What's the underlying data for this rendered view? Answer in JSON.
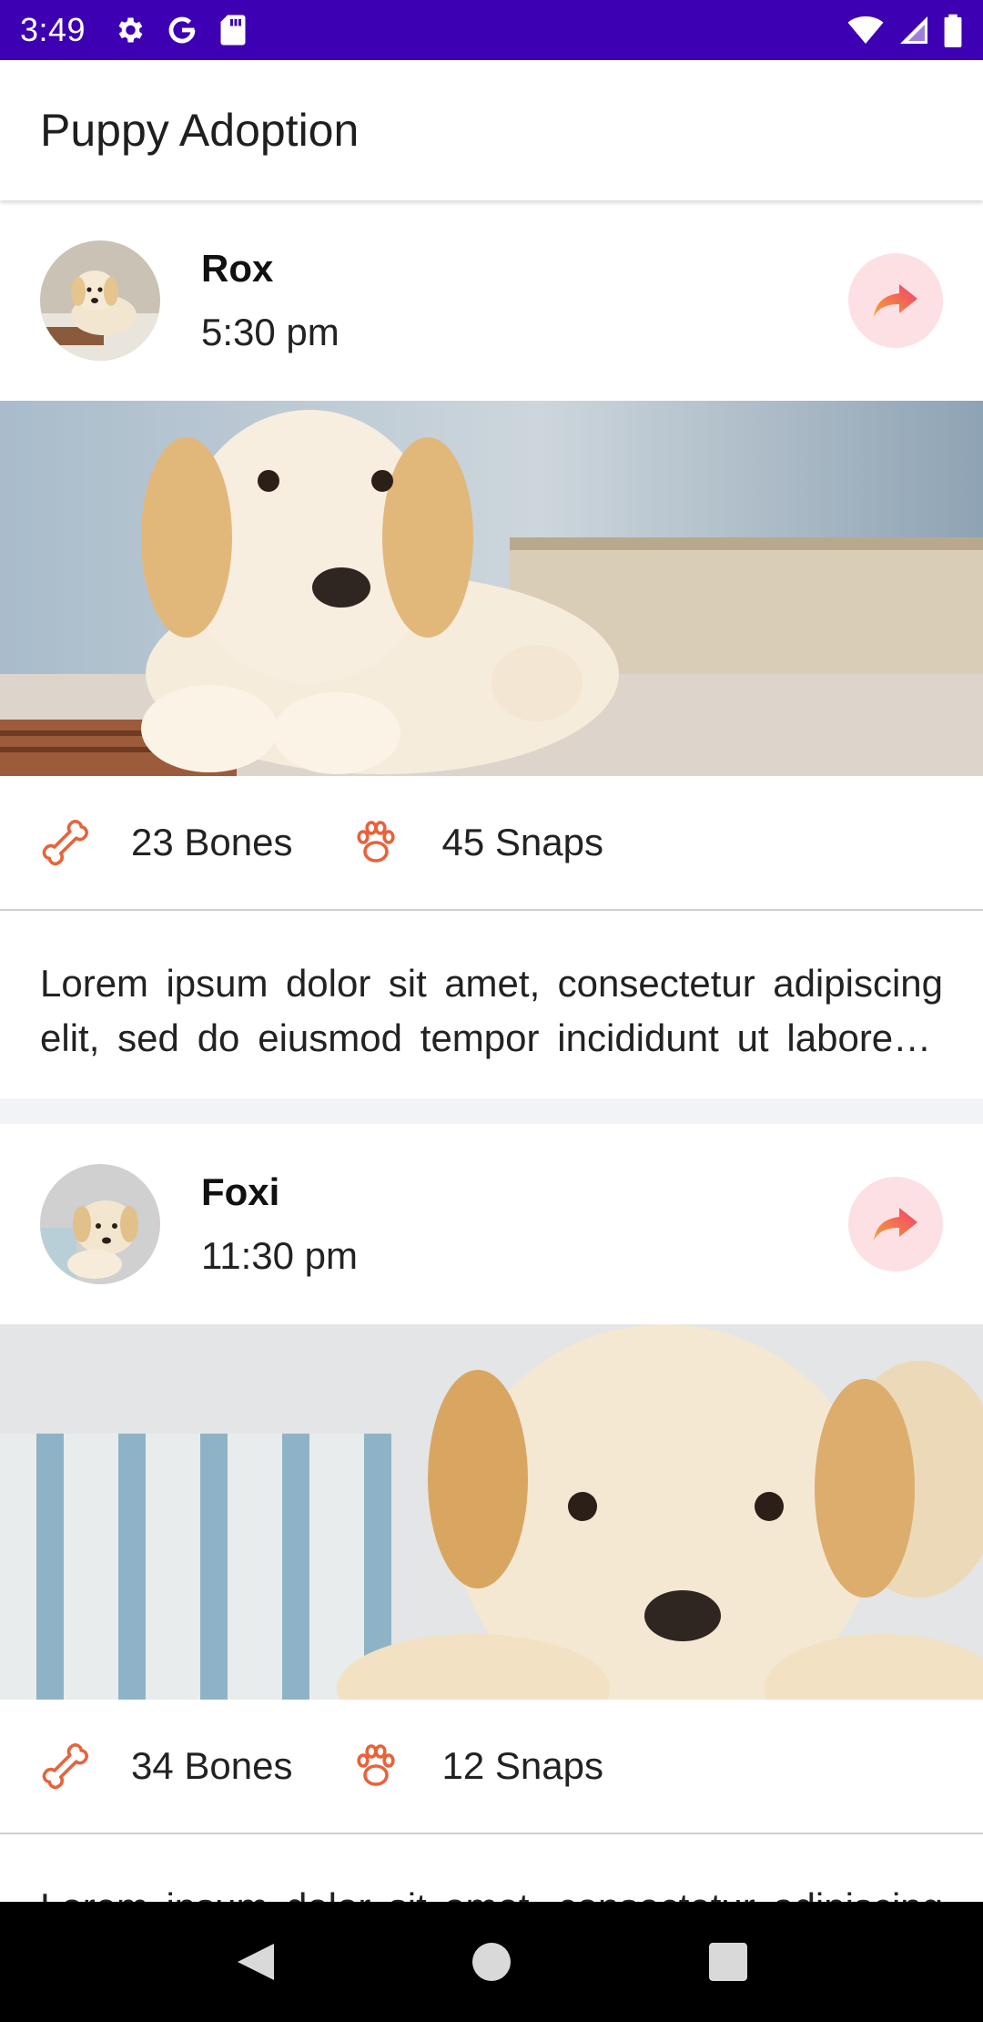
{
  "status_bar": {
    "time": "3:49",
    "left_icons": [
      "gear-icon",
      "google-icon",
      "sd-card-icon"
    ],
    "right_icons": [
      "wifi-icon",
      "signal-icon",
      "battery-icon"
    ],
    "background": "#3d00b3"
  },
  "app_bar": {
    "title": "Puppy Adoption"
  },
  "posts": [
    {
      "name": "Rox",
      "time": "5:30 pm",
      "bones": "23 Bones",
      "snaps": "45 Snaps",
      "description": "Lorem ipsum dolor sit amet, consectetur adipiscing elit, sed do eiusmod tempor incididunt ut labore et dolore magna aliqua."
    },
    {
      "name": "Foxi",
      "time": "11:30 pm",
      "bones": "34 Bones",
      "snaps": "12 Snaps",
      "description": "Lorem ipsum dolor sit amet, consectetur adipiscing elit, sed do eiusmod tempor incididunt ut labore et dolore magna aliqua."
    }
  ],
  "colors": {
    "accent_orange": "#e8623a",
    "share_bg": "#fde0e3",
    "share_arrow_start": "#f7a234",
    "share_arrow_end": "#ef3f6e"
  },
  "nav_bar": {
    "buttons": [
      "back-icon",
      "home-icon",
      "recents-icon"
    ]
  }
}
